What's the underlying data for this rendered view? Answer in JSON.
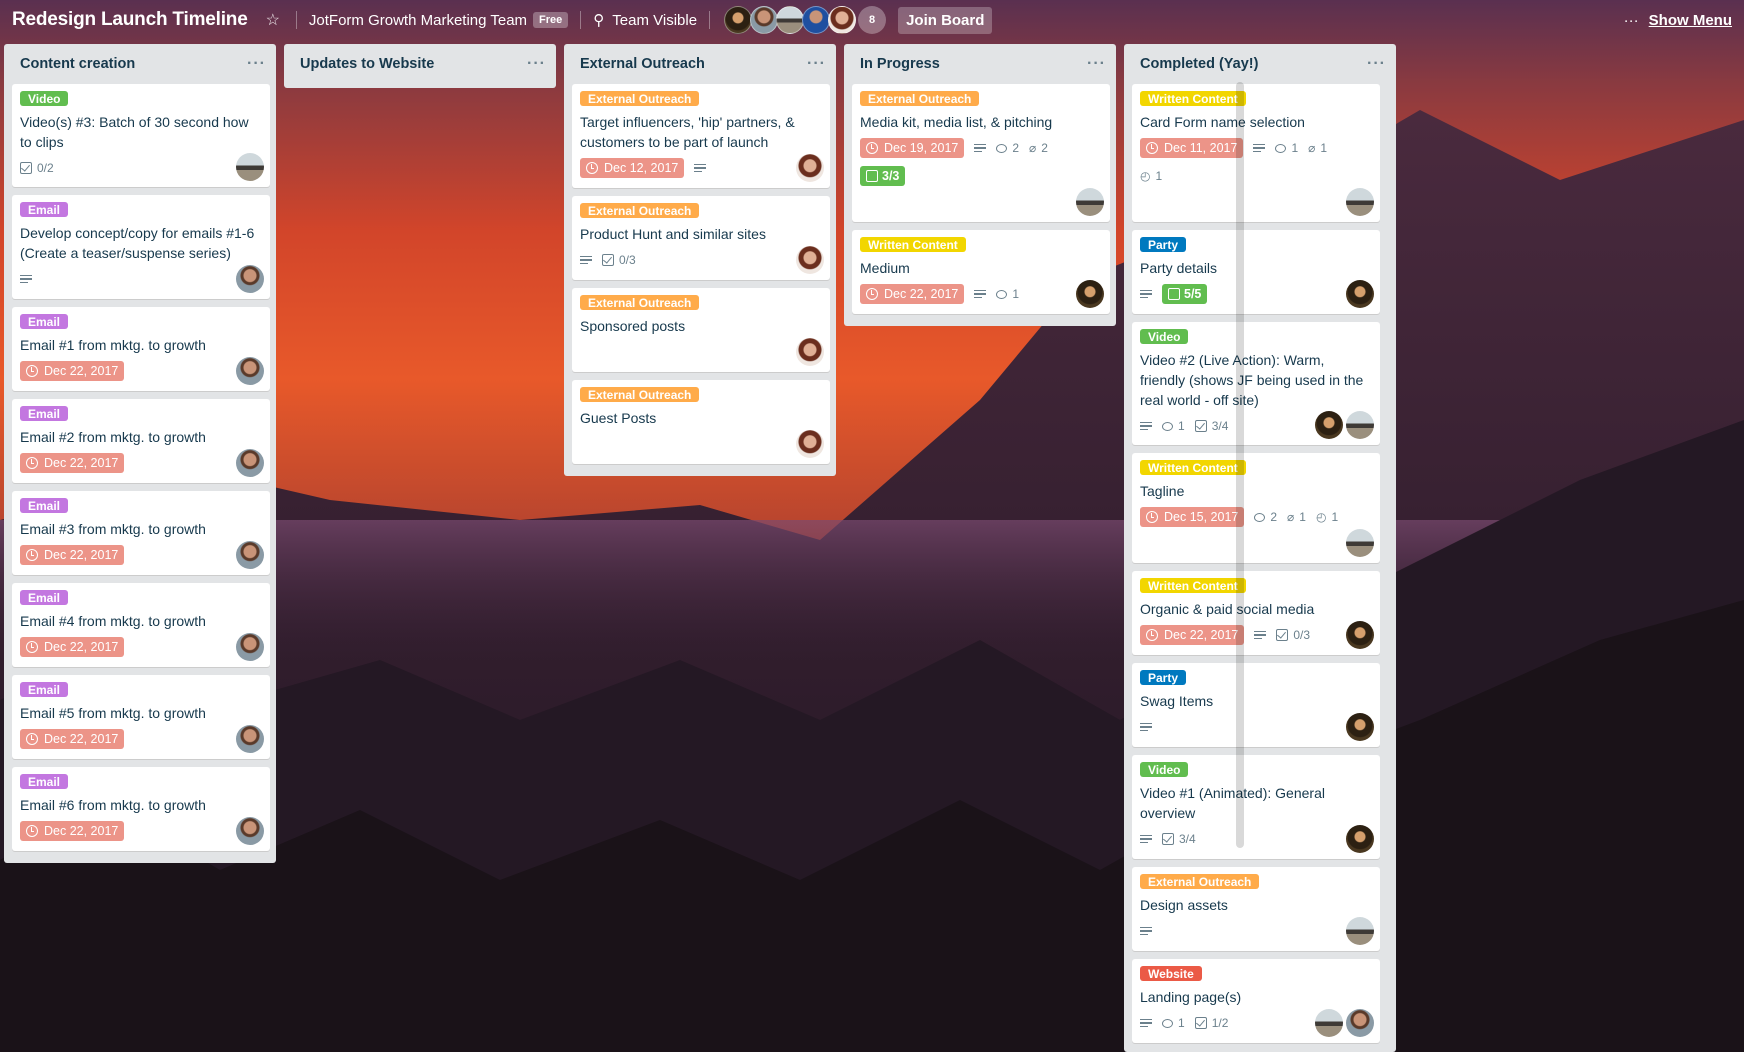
{
  "header": {
    "board_title": "Redesign Launch Timeline",
    "team_name": "JotForm Growth Marketing Team",
    "team_badge": "Free",
    "visibility": "Team Visible",
    "member_count": "8",
    "join_button": "Join Board",
    "menu_dots": "···",
    "show_menu": "Show Menu"
  },
  "lists": [
    {
      "title": "Content creation",
      "cards": [
        {
          "label": "Video",
          "label_color": "#61bd4f",
          "title": "Video(s) #3: Batch of 30 second how to clips",
          "checklist": "0/2"
        },
        {
          "label": "Email",
          "label_color": "#c377e0",
          "title": "Develop concept/copy for emails #1-6 (Create a teaser/suspense series)"
        },
        {
          "label": "Email",
          "label_color": "#c377e0",
          "title": "Email #1 from mktg. to growth",
          "due": "Dec 22, 2017"
        },
        {
          "label": "Email",
          "label_color": "#c377e0",
          "title": "Email #2 from mktg. to growth",
          "due": "Dec 22, 2017"
        },
        {
          "label": "Email",
          "label_color": "#c377e0",
          "title": "Email #3 from mktg. to growth",
          "due": "Dec 22, 2017"
        },
        {
          "label": "Email",
          "label_color": "#c377e0",
          "title": "Email #4 from mktg. to growth",
          "due": "Dec 22, 2017"
        },
        {
          "label": "Email",
          "label_color": "#c377e0",
          "title": "Email #5 from mktg. to growth",
          "due": "Dec 22, 2017"
        },
        {
          "label": "Email",
          "label_color": "#c377e0",
          "title": "Email #6 from mktg. to growth",
          "due": "Dec 22, 2017"
        }
      ]
    },
    {
      "title": "Updates to Website",
      "cards": []
    },
    {
      "title": "External Outreach",
      "cards": [
        {
          "label": "External Outreach",
          "label_color": "#ffab4a",
          "title": "Target influencers, 'hip' partners, & customers to be part of launch",
          "due": "Dec 12, 2017"
        },
        {
          "label": "External Outreach",
          "label_color": "#ffab4a",
          "title": "Product Hunt and similar sites",
          "checklist": "0/3"
        },
        {
          "label": "External Outreach",
          "label_color": "#ffab4a",
          "title": "Sponsored posts"
        },
        {
          "label": "External Outreach",
          "label_color": "#ffab4a",
          "title": "Guest Posts"
        }
      ]
    },
    {
      "title": "In Progress",
      "cards": [
        {
          "label": "External Outreach",
          "label_color": "#ffab4a",
          "title": "Media kit, media list, & pitching",
          "due": "Dec 19, 2017",
          "comments": "2",
          "attachments": "2",
          "checklist_done": "3/3"
        },
        {
          "label": "Written Content",
          "label_color": "#f2d600",
          "title": "Medium",
          "due": "Dec 22, 2017",
          "comments": "1"
        }
      ]
    },
    {
      "title": "Completed (Yay!)",
      "cards": [
        {
          "label": "Written Content",
          "label_color": "#f2d600",
          "title": "Card Form name selection",
          "due": "Dec 11, 2017",
          "comments": "1",
          "attachments": "1",
          "votes": "1"
        },
        {
          "label": "Party",
          "label_color": "#0079bf",
          "title": "Party details",
          "checklist_done": "5/5"
        },
        {
          "label": "Video",
          "label_color": "#61bd4f",
          "title": "Video #2 (Live Action): Warm, friendly (shows JF being used in the real world - off site)",
          "comments": "1",
          "checklist": "3/4"
        },
        {
          "label": "Written Content",
          "label_color": "#f2d600",
          "title": "Tagline",
          "due": "Dec 15, 2017",
          "comments": "2",
          "attachments": "1",
          "votes": "1"
        },
        {
          "label": "Written Content",
          "label_color": "#f2d600",
          "title": "Organic & paid social media",
          "due": "Dec 22, 2017",
          "checklist": "0/3"
        },
        {
          "label": "Party",
          "label_color": "#0079bf",
          "title": "Swag Items"
        },
        {
          "label": "Video",
          "label_color": "#61bd4f",
          "title": "Video #1 (Animated): General overview",
          "checklist": "3/4"
        },
        {
          "label": "External Outreach",
          "label_color": "#ffab4a",
          "title": "Design assets"
        },
        {
          "label": "Website",
          "label_color": "#eb5a46",
          "title": "Landing page(s)",
          "comments": "1",
          "checklist": "1/2"
        }
      ]
    }
  ]
}
